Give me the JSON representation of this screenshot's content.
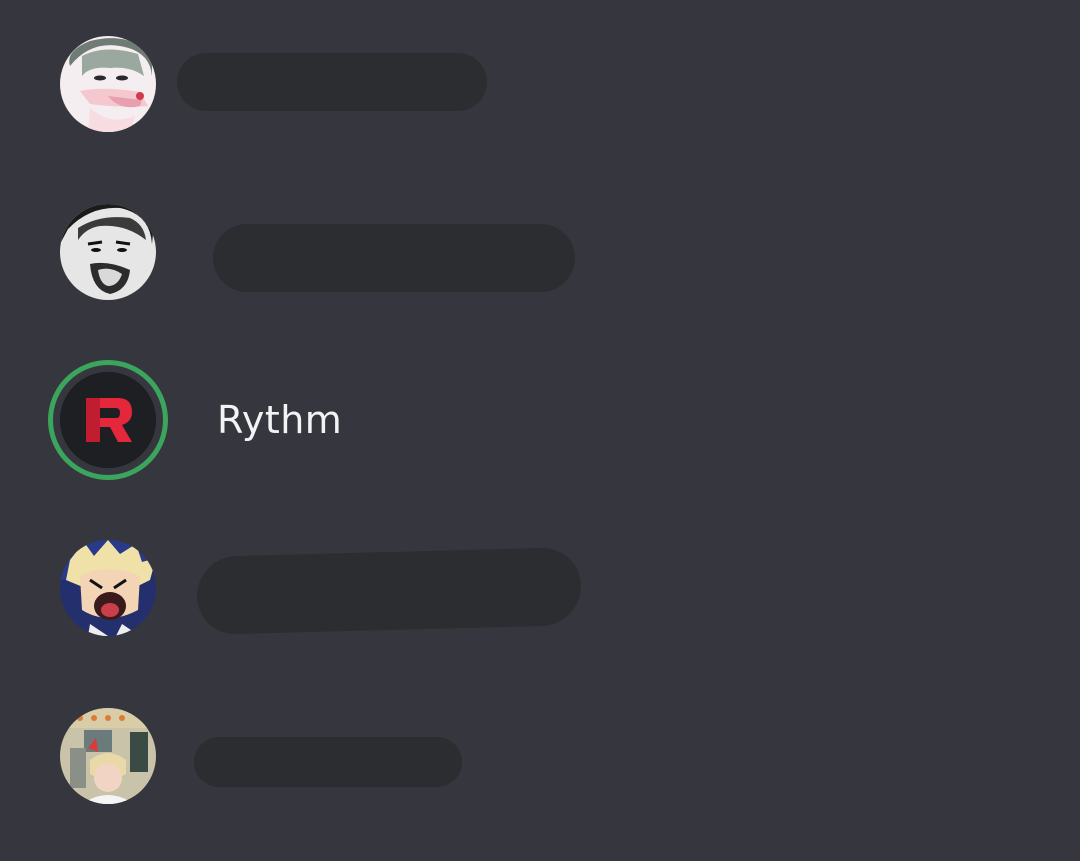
{
  "members": [
    {
      "avatar_icon": "user-avatar-photo",
      "name": ""
    },
    {
      "avatar_icon": "user-avatar-photo",
      "name": ""
    },
    {
      "avatar_icon": "rythm-bot-logo",
      "name": "Rythm",
      "status": "online",
      "status_color": "#3ba55d"
    },
    {
      "avatar_icon": "user-avatar-anime",
      "name": ""
    },
    {
      "avatar_icon": "user-avatar-photo",
      "name": ""
    }
  ],
  "colors": {
    "background": "#36373e",
    "redacted_bar": "#2b2d31",
    "text": "#f2f3f5",
    "rythm_red": "#e5273c"
  }
}
